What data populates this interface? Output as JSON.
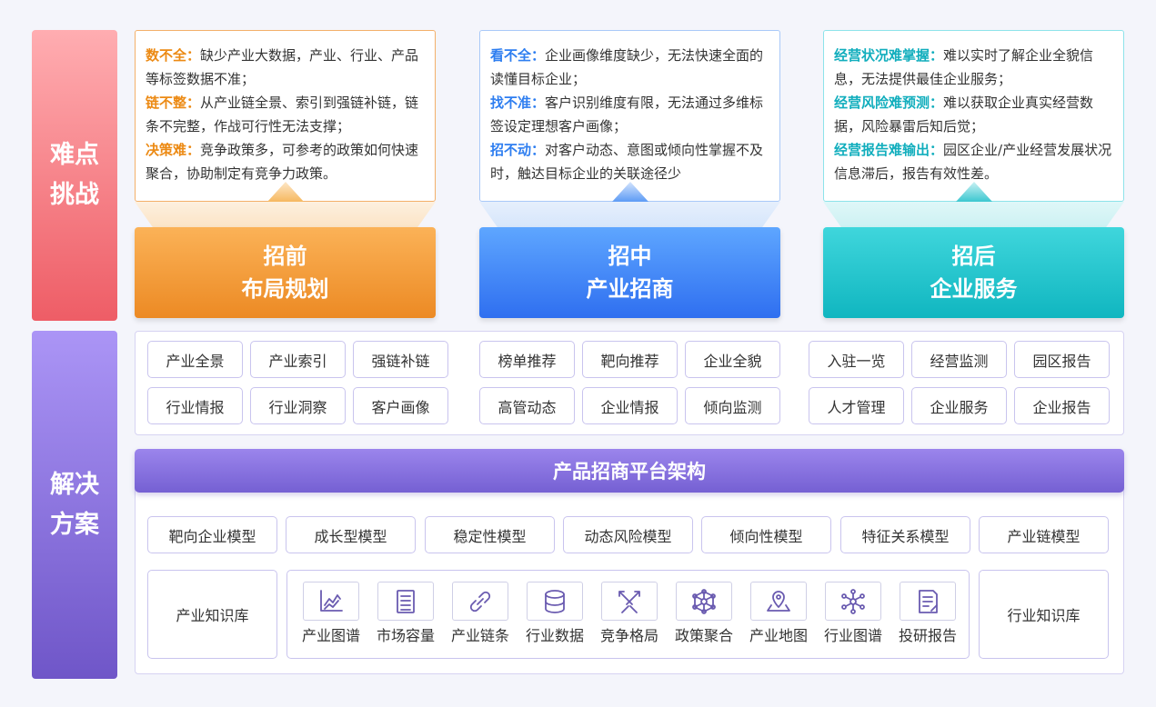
{
  "side": {
    "top": [
      "难点",
      "挑战"
    ],
    "bottom": [
      "解决",
      "方案"
    ]
  },
  "problems": [
    {
      "color": "#ec8a14",
      "items": [
        {
          "key": "数不全：",
          "text": "缺少产业大数据，产业、行业、产品等标签数据不准；"
        },
        {
          "key": "链不整：",
          "text": "从产业链全景、索引到强链补链，链条不完整，作战可行性无法支撑；"
        },
        {
          "key": "决策难：",
          "text": "竞争政策多，可参考的政策如何快速聚合，协助制定有竞争力政策。"
        }
      ]
    },
    {
      "color": "#2e7ef0",
      "items": [
        {
          "key": "看不全：",
          "text": "企业画像维度缺少，无法快速全面的读懂目标企业；"
        },
        {
          "key": "找不准：",
          "text": "客户识别维度有限，无法通过多维标签设定理想客户画像；"
        },
        {
          "key": "招不动：",
          "text": "对客户动态、意图或倾向性掌握不及时，触达目标企业的关联途径少"
        }
      ]
    },
    {
      "color": "#12aebd",
      "items": [
        {
          "key": "经营状况难掌握：",
          "text": "难以实时了解企业全貌信息，无法提供最佳企业服务；"
        },
        {
          "key": "经营风险难预测：",
          "text": "难以获取企业真实经营数据，风险暴雷后知后觉；"
        },
        {
          "key": "经营报告难输出：",
          "text": "园区企业/产业经营发展状况信息滞后，报告有效性差。"
        }
      ]
    }
  ],
  "phases": [
    {
      "line1": "招前",
      "line2": "布局规划"
    },
    {
      "line1": "招中",
      "line2": "产业招商"
    },
    {
      "line1": "招后",
      "line2": "企业服务"
    }
  ],
  "modules": [
    [
      "产业全景",
      "产业索引",
      "强链补链",
      "行业情报",
      "行业洞察",
      "客户画像"
    ],
    [
      "榜单推荐",
      "靶向推荐",
      "企业全貌",
      "高管动态",
      "企业情报",
      "倾向监测"
    ],
    [
      "入驻一览",
      "经营监测",
      "园区报告",
      "人才管理",
      "企业服务",
      "企业报告"
    ]
  ],
  "platform": {
    "title": "产品招商平台架构",
    "models": [
      "靶向企业模型",
      "成长型模型",
      "稳定性模型",
      "动态风险模型",
      "倾向性模型",
      "特征关系模型",
      "产业链模型"
    ],
    "kb_left": "产业知识库",
    "kb_right": "行业知识库",
    "data_items": [
      {
        "label": "产业图谱",
        "icon": "chart-icon"
      },
      {
        "label": "市场容量",
        "icon": "list-icon"
      },
      {
        "label": "产业链条",
        "icon": "chain-icon"
      },
      {
        "label": "行业数据",
        "icon": "database-icon"
      },
      {
        "label": "竞争格局",
        "icon": "swords-icon"
      },
      {
        "label": "政策聚合",
        "icon": "network-icon"
      },
      {
        "label": "产业地图",
        "icon": "map-pin-icon"
      },
      {
        "label": "行业图谱",
        "icon": "molecule-icon"
      },
      {
        "label": "投研报告",
        "icon": "report-icon"
      }
    ]
  },
  "colors": {
    "orange": "#ec8a24",
    "blue": "#2f6ff0",
    "teal": "#10b6c0",
    "purple": "#7560d3",
    "red": "#ee5d66",
    "icon": "#6a5bb0"
  }
}
